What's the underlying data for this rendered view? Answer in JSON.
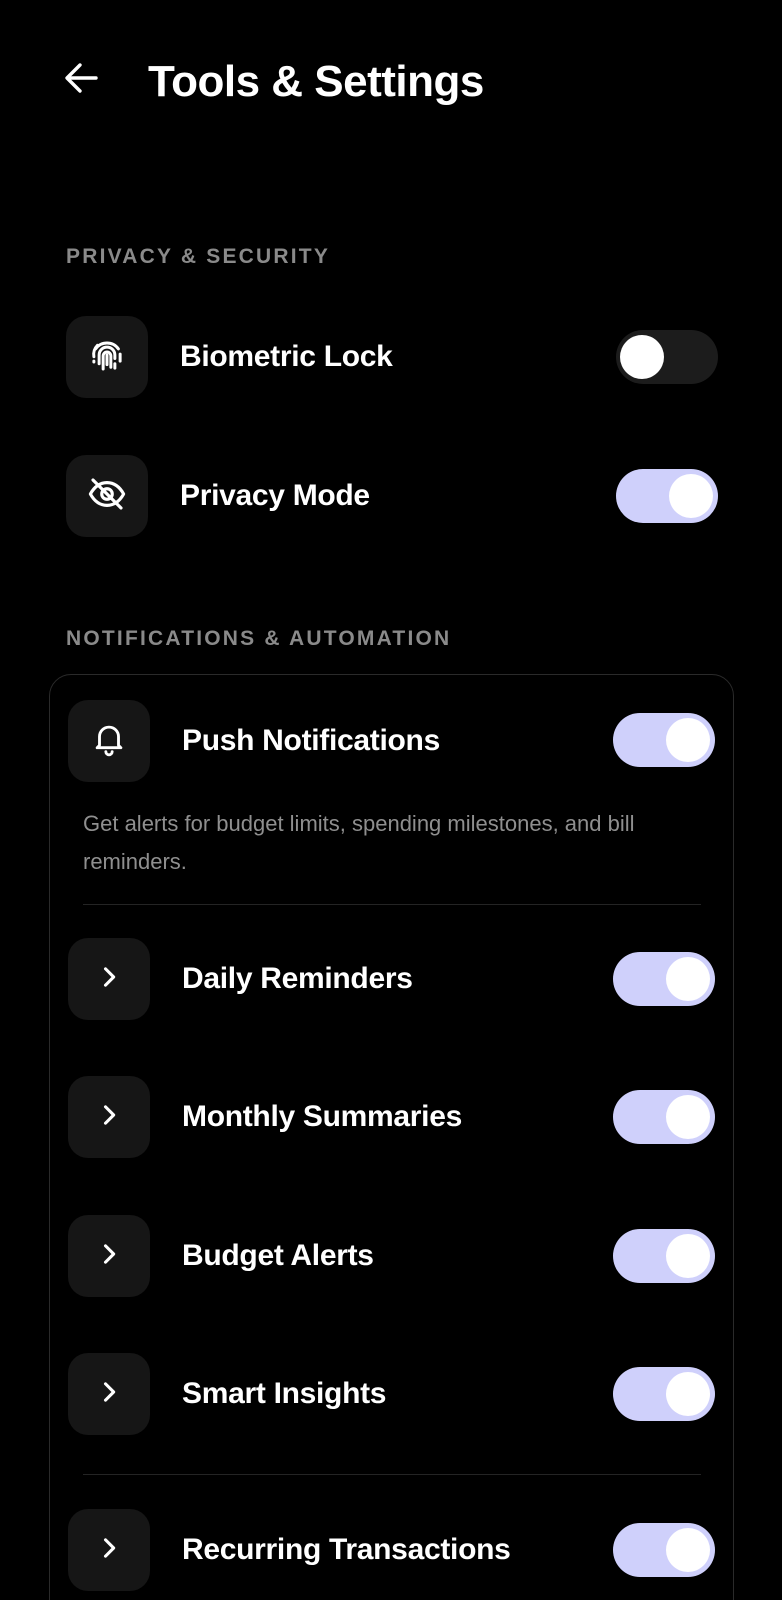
{
  "header": {
    "title": "Tools & Settings",
    "back_icon": "arrow-left-icon"
  },
  "sections": {
    "privacy": {
      "label": "PRIVACY & SECURITY",
      "items": [
        {
          "label": "Biometric Lock",
          "icon": "fingerprint-icon",
          "enabled": false
        },
        {
          "label": "Privacy Mode",
          "icon": "eye-off-icon",
          "enabled": true
        }
      ]
    },
    "notifications": {
      "label": "NOTIFICATIONS & AUTOMATION",
      "push": {
        "label": "Push Notifications",
        "icon": "bell-icon",
        "enabled": true,
        "description": "Get alerts for budget limits, spending milestones, and bill reminders."
      },
      "items": [
        {
          "label": "Daily Reminders",
          "icon": "chevron-right-icon",
          "enabled": true
        },
        {
          "label": "Monthly Summaries",
          "icon": "chevron-right-icon",
          "enabled": true
        },
        {
          "label": "Budget Alerts",
          "icon": "chevron-right-icon",
          "enabled": true
        },
        {
          "label": "Smart Insights",
          "icon": "chevron-right-icon",
          "enabled": true
        },
        {
          "label": "Recurring Transactions",
          "icon": "chevron-right-icon",
          "enabled": true
        }
      ]
    }
  },
  "colors": {
    "background": "#000000",
    "toggle_on": "#cfd0fb",
    "toggle_off": "#1c1c1c",
    "icon_box": "#161616",
    "section_label": "#8a8a8a"
  }
}
